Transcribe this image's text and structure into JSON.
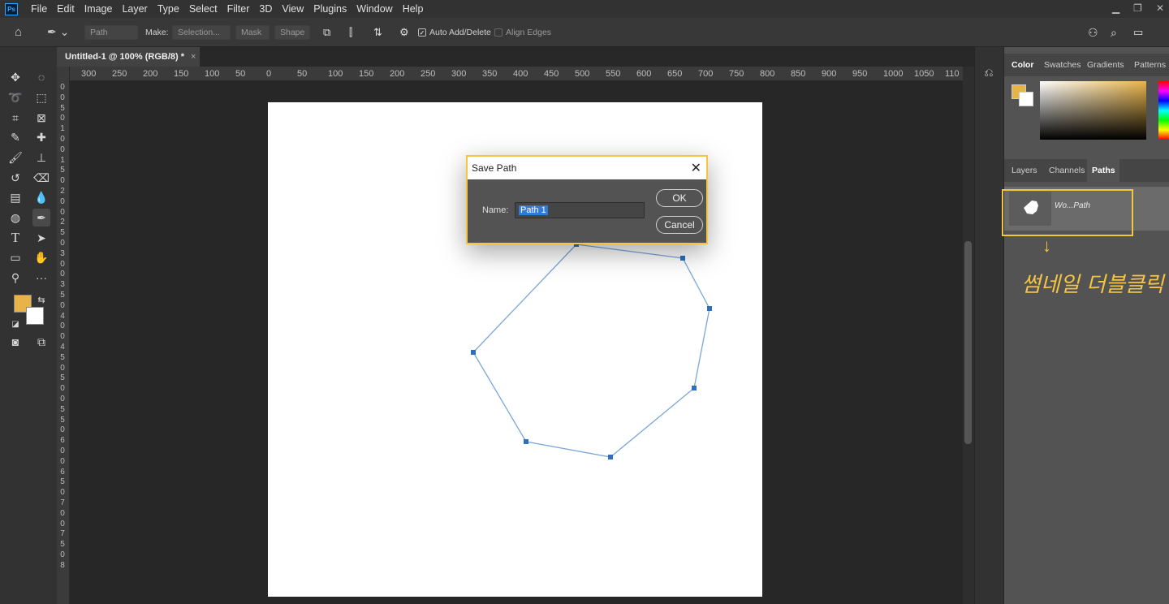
{
  "app": {
    "logo": "Ps"
  },
  "menu": [
    "File",
    "Edit",
    "Image",
    "Layer",
    "Type",
    "Select",
    "Filter",
    "3D",
    "View",
    "Plugins",
    "Window",
    "Help"
  ],
  "options": {
    "path_mode": "Path",
    "make_label": "Make:",
    "selection_btn": "Selection...",
    "mask_btn": "Mask",
    "shape_btn": "Shape",
    "auto_add_delete": "Auto Add/Delete",
    "auto_add_checked": true,
    "align_edges": "Align Edges"
  },
  "document_tab": {
    "title": "Untitled-1 @ 100% (RGB/8) *",
    "close": "×"
  },
  "ruler_top": [
    "300",
    "250",
    "200",
    "150",
    "100",
    "50",
    "0",
    "50",
    "100",
    "150",
    "200",
    "250",
    "300",
    "350",
    "400",
    "450",
    "500",
    "550",
    "600",
    "650",
    "700",
    "750",
    "800",
    "850",
    "900",
    "950",
    "1000",
    "1050",
    "110"
  ],
  "ruler_left": [
    "0",
    "0",
    "5",
    "0",
    "1",
    "0",
    "0",
    "1",
    "5",
    "0",
    "2",
    "0",
    "0",
    "2",
    "5",
    "0",
    "3",
    "0",
    "0",
    "3",
    "5",
    "0",
    "4",
    "0",
    "0",
    "4",
    "5",
    "0",
    "5",
    "0",
    "0",
    "5",
    "5",
    "0",
    "6",
    "0",
    "0",
    "6",
    "5",
    "0",
    "7",
    "0",
    "0",
    "7",
    "5",
    "0",
    "8"
  ],
  "colors": {
    "foreground": "#e8b44a",
    "background": "#ffffff",
    "accent": "#f5c542",
    "path": "#4a8fd6"
  },
  "dialog": {
    "title": "Save Path",
    "name_label": "Name:",
    "name_value": "Path 1",
    "ok": "OK",
    "cancel": "Cancel"
  },
  "color_panel": {
    "tabs": [
      "Color",
      "Swatches",
      "Gradients",
      "Patterns"
    ]
  },
  "layers_panel": {
    "tabs": [
      "Layers",
      "Channels",
      "Paths"
    ],
    "active": "Paths"
  },
  "path_item": {
    "label": "Wo...Path"
  },
  "annotation": "썸네일 더블클릭"
}
